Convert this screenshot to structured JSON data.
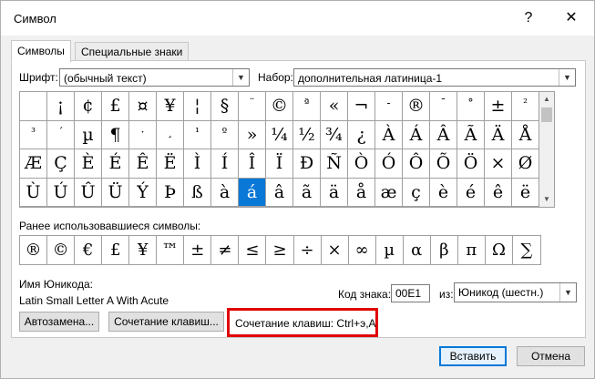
{
  "window": {
    "title": "Символ",
    "help_button": "?",
    "close_button": "✕"
  },
  "tabs": [
    {
      "label": "Символы",
      "active": true
    },
    {
      "label": "Специальные знаки",
      "active": false
    }
  ],
  "font": {
    "label": "Шрифт:",
    "value": "(обычный текст)"
  },
  "subset": {
    "label": "Набор:",
    "value": "дополнительная латиница-1"
  },
  "symbol_grid": {
    "rows": [
      [
        " ",
        "¡",
        "¢",
        "£",
        "¤",
        "¥",
        "¦",
        "§",
        "¨",
        "©",
        "ª",
        "«",
        "¬",
        "-",
        "®",
        "¯",
        "°",
        "±",
        "²"
      ],
      [
        "³",
        "´",
        "µ",
        "¶",
        "·",
        "¸",
        "¹",
        "º",
        "»",
        "¼",
        "½",
        "¾",
        "¿",
        "À",
        "Á",
        "Â",
        "Ã",
        "Ä",
        "Å"
      ],
      [
        "Æ",
        "Ç",
        "È",
        "É",
        "Ê",
        "Ë",
        "Ì",
        "Í",
        "Î",
        "Ï",
        "Ð",
        "Ñ",
        "Ò",
        "Ó",
        "Ô",
        "Õ",
        "Ö",
        "×",
        "Ø"
      ],
      [
        "Ù",
        "Ú",
        "Û",
        "Ü",
        "Ý",
        "Þ",
        "ß",
        "à",
        "á",
        "â",
        "ã",
        "ä",
        "å",
        "æ",
        "ç",
        "è",
        "é",
        "ê",
        "ë"
      ]
    ],
    "selected": "á"
  },
  "recent": {
    "label": "Ранее использовавшиеся символы:",
    "symbols": [
      "®",
      "©",
      "€",
      "£",
      "¥",
      "™",
      "±",
      "≠",
      "≤",
      "≥",
      "÷",
      "×",
      "∞",
      "µ",
      "α",
      "β",
      "π",
      "Ω",
      "∑"
    ]
  },
  "unicode_name": {
    "label": "Имя Юникода:",
    "value": "Latin Small Letter A With Acute"
  },
  "char_code": {
    "label": "Код знака:",
    "value": "00E1"
  },
  "from": {
    "label": "из:",
    "value": "Юникод (шестн.)"
  },
  "buttons": {
    "autocorrect": "Автозамена...",
    "shortcut_key": "Сочетание клавиш...",
    "insert": "Вставить",
    "cancel": "Отмена"
  },
  "shortcut_text": "Сочетание клавиш: Ctrl+э,A",
  "colors": {
    "selection": "#0a78d7",
    "highlight_frame": "#e00000",
    "primary_border": "#0078d7"
  }
}
